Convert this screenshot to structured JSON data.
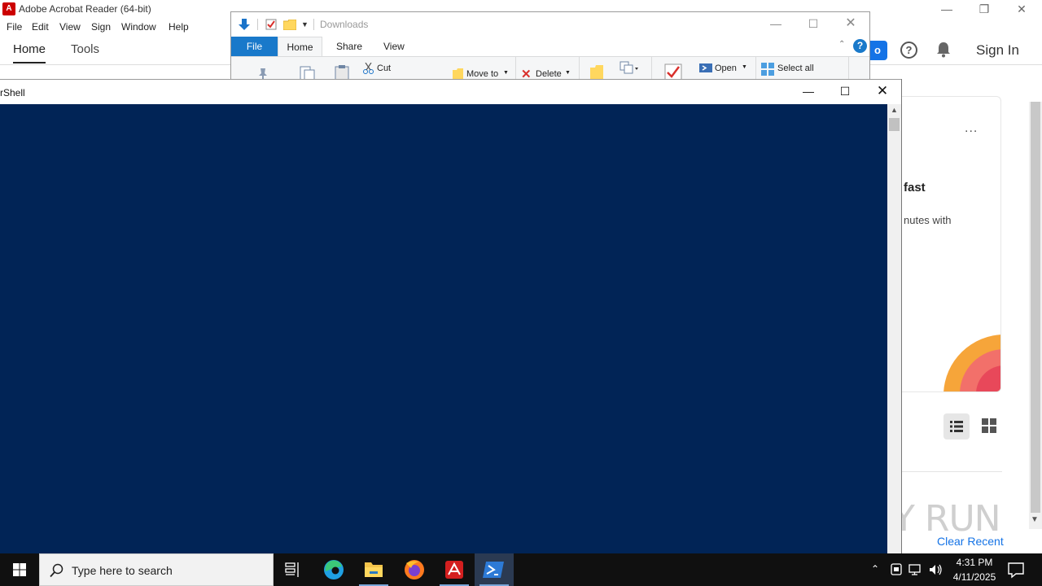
{
  "acrobat": {
    "title": "Adobe Acrobat Reader (64-bit)",
    "menu": [
      "File",
      "Edit",
      "View",
      "Sign",
      "Window",
      "Help"
    ],
    "tabs": {
      "home": "Home",
      "tools": "Tools"
    },
    "signin": "Sign In",
    "panel": {
      "heading_fragment": "fast",
      "body_fragment": "nutes with",
      "more": "..."
    },
    "clear_recent": "Clear Recent",
    "accent_color": "#1473e6"
  },
  "explorer": {
    "title": "Downloads",
    "tabs": {
      "file": "File",
      "home": "Home",
      "share": "Share",
      "view": "View"
    },
    "ribbon": {
      "cut": "Cut",
      "move_to": "Move to",
      "delete": "Delete",
      "open": "Open",
      "select_all": "Select all"
    },
    "file_tab_color": "#1979ca"
  },
  "powershell": {
    "title_fragment": "rShell",
    "console_color": "#012456"
  },
  "taskbar": {
    "search_placeholder": "Type here to search",
    "apps": [
      "task-view",
      "edge",
      "file-explorer",
      "firefox",
      "acrobat",
      "powershell"
    ],
    "clock": {
      "time": "4:31 PM",
      "date": "4/11/2025"
    }
  },
  "watermark": {
    "text": "ANY RUN"
  }
}
